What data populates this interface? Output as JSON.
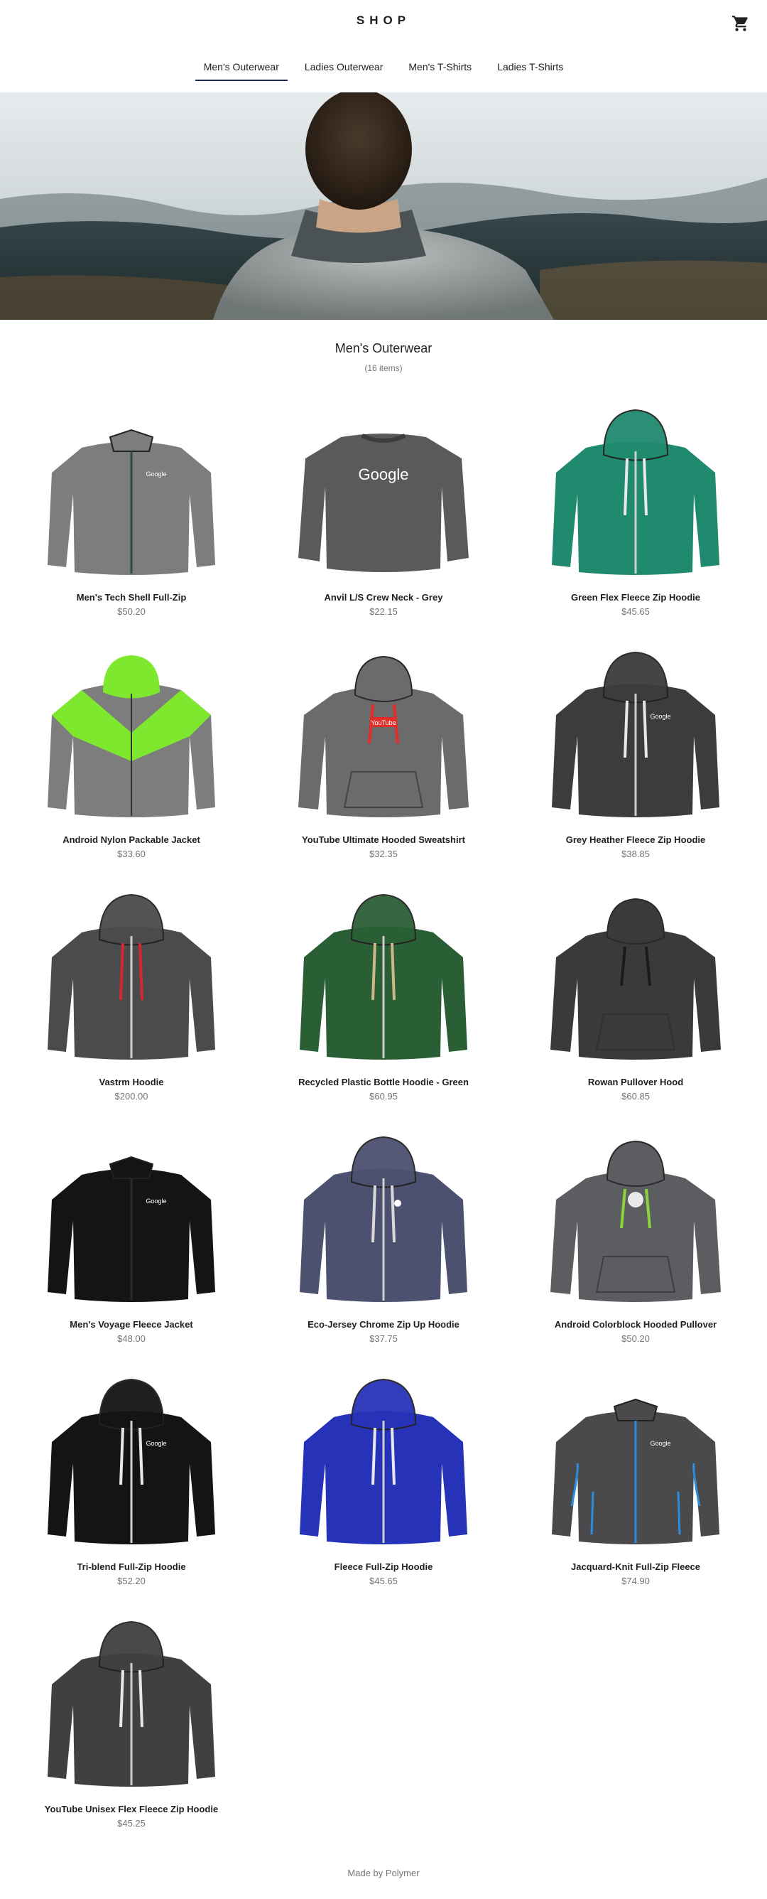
{
  "header": {
    "logo": "SHOP",
    "cart_icon": "cart-icon"
  },
  "tabs": [
    {
      "label": "Men's Outerwear",
      "active": true
    },
    {
      "label": "Ladies Outerwear",
      "active": false
    },
    {
      "label": "Men's T-Shirts",
      "active": false
    },
    {
      "label": "Ladies T-Shirts",
      "active": false
    }
  ],
  "category": {
    "title": "Men's Outerwear",
    "count": "(16 items)"
  },
  "products": [
    {
      "name": "Men's Tech Shell Full-Zip",
      "price": "$50.20",
      "style": "zip",
      "color": "#7b7e7c",
      "accent": "#2c4a3e",
      "logo": "Google"
    },
    {
      "name": "Anvil L/S Crew Neck - Grey",
      "price": "$22.15",
      "style": "crew",
      "color": "#5a5a5c",
      "accent": "#5a5a5c",
      "logo": "Google"
    },
    {
      "name": "Green Flex Fleece Zip Hoodie",
      "price": "$45.65",
      "style": "hoodie",
      "color": "#1f8a6e",
      "accent": "#e8e8e8",
      "logo": ""
    },
    {
      "name": "Android Nylon Packable Jacket",
      "price": "$33.60",
      "style": "jacket2",
      "color": "#7d7d7d",
      "accent": "#7ee82e",
      "logo": ""
    },
    {
      "name": "YouTube Ultimate Hooded Sweatshirt",
      "price": "$32.35",
      "style": "pullover",
      "color": "#6b6b6b",
      "accent": "#e52d27",
      "logo": "YouTube"
    },
    {
      "name": "Grey Heather Fleece Zip Hoodie",
      "price": "$38.85",
      "style": "hoodie",
      "color": "#3b3c3e",
      "accent": "#e8e8e8",
      "logo": "Google"
    },
    {
      "name": "Vastrm Hoodie",
      "price": "$200.00",
      "style": "hoodie",
      "color": "#4a4b4d",
      "accent": "#d8262f",
      "logo": ""
    },
    {
      "name": "Recycled Plastic Bottle Hoodie - Green",
      "price": "$60.95",
      "style": "hoodie",
      "color": "#2a5e35",
      "accent": "#c9b98a",
      "logo": ""
    },
    {
      "name": "Rowan Pullover Hood",
      "price": "$60.85",
      "style": "pullover",
      "color": "#3a3a3c",
      "accent": "#1a1a1a",
      "logo": ""
    },
    {
      "name": "Men's Voyage Fleece Jacket",
      "price": "$48.00",
      "style": "zip",
      "color": "#141414",
      "accent": "#2a2a2a",
      "logo": "Google"
    },
    {
      "name": "Eco-Jersey Chrome Zip Up Hoodie",
      "price": "$37.75",
      "style": "hoodie",
      "color": "#4c5170",
      "accent": "#d8d8d8",
      "logo": "chrome"
    },
    {
      "name": "Android Colorblock Hooded Pullover",
      "price": "$50.20",
      "style": "pullover",
      "color": "#5c5d60",
      "accent": "#8bd43a",
      "logo": "android"
    },
    {
      "name": "Tri-blend Full-Zip Hoodie",
      "price": "$52.20",
      "style": "hoodie",
      "color": "#141414",
      "accent": "#e8e8e8",
      "logo": "Google"
    },
    {
      "name": "Fleece Full-Zip Hoodie",
      "price": "$45.65",
      "style": "hoodie",
      "color": "#2633b8",
      "accent": "#e8e8e8",
      "logo": ""
    },
    {
      "name": "Jacquard-Knit Full-Zip Fleece",
      "price": "$74.90",
      "style": "zip",
      "color": "#4a4a4c",
      "accent": "#2b8de0",
      "logo": "Google"
    },
    {
      "name": "YouTube Unisex Flex Fleece Zip Hoodie",
      "price": "$45.25",
      "style": "hoodie",
      "color": "#404043",
      "accent": "#e8e8e8",
      "logo": ""
    }
  ],
  "footer": {
    "text": "Made by Polymer"
  }
}
